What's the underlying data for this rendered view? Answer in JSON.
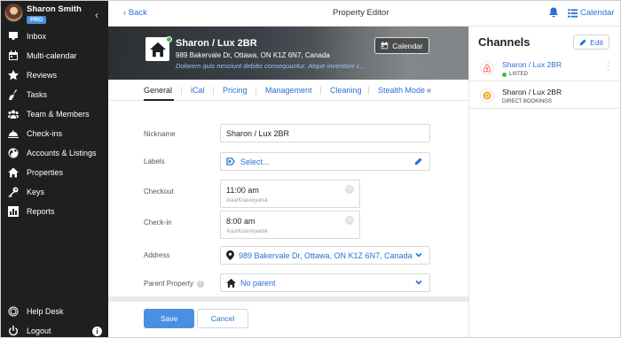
{
  "user": {
    "name": "Sharon Smith",
    "badge": "PRO"
  },
  "sidebar": {
    "items": [
      {
        "label": "Inbox",
        "icon": "inbox-icon"
      },
      {
        "label": "Multi-calendar",
        "icon": "calendar-icon"
      },
      {
        "label": "Reviews",
        "icon": "star-icon"
      },
      {
        "label": "Tasks",
        "icon": "broom-icon"
      },
      {
        "label": "Team & Members",
        "icon": "users-icon"
      },
      {
        "label": "Check-ins",
        "icon": "bell-service-icon"
      },
      {
        "label": "Accounts & Listings",
        "icon": "globe-icon"
      },
      {
        "label": "Properties",
        "icon": "home-icon"
      },
      {
        "label": "Keys",
        "icon": "key-icon"
      },
      {
        "label": "Reports",
        "icon": "chart-icon"
      }
    ],
    "bottom": [
      {
        "label": "Help Desk",
        "icon": "lifebuoy-icon"
      },
      {
        "label": "Logout",
        "icon": "power-icon"
      }
    ]
  },
  "topbar": {
    "back": "Back",
    "title": "Property Editor",
    "calendar": "Calendar"
  },
  "property": {
    "name": "Sharon / Lux 2BR",
    "address": "989 Bakervale Dr, Ottawa, ON K1Z 6N7, Canada",
    "description": "Dolorem quis nesciunt debitis consequuntur. Atque inventore c...",
    "calendar_button": "Calendar"
  },
  "tabs": [
    "General",
    "iCal",
    "Pricing",
    "Management",
    "Cleaning",
    "Stealth Mode"
  ],
  "form": {
    "nickname": {
      "label": "Nickname",
      "value": "Sharon / Lux 2BR"
    },
    "labels": {
      "label": "Labels",
      "value": "Select..."
    },
    "checkout": {
      "label": "Checkout",
      "value": "11:00 am",
      "timezone": "Asia/Krasnoyarsk"
    },
    "checkin": {
      "label": "Check-in",
      "value": "8:00 am",
      "timezone": "Asia/Krasnoyarsk"
    },
    "address": {
      "label": "Address",
      "value": "989 Bakervale Dr, Ottawa, ON K1Z 6N7, Canada"
    },
    "parent": {
      "label": "Parent Property",
      "value": "No parent"
    }
  },
  "footer": {
    "save": "Save",
    "cancel": "Cancel"
  },
  "channels": {
    "title": "Channels",
    "edit": "Edit",
    "items": [
      {
        "name": "Sharon / Lux 2BR",
        "status": "LISTED",
        "icon": "airbnb-icon"
      },
      {
        "name": "Sharon / Lux 2BR",
        "status": "DIRECT BOOKINGS",
        "icon": "direct-booking-icon"
      }
    ]
  },
  "colors": {
    "accent": "#2b6fd6",
    "sidebar": "#1f1f1f",
    "primary_button": "#4a90e2",
    "listed": "#3fb950",
    "airbnb": "#ff5a5f",
    "direct": "#f5a623"
  }
}
